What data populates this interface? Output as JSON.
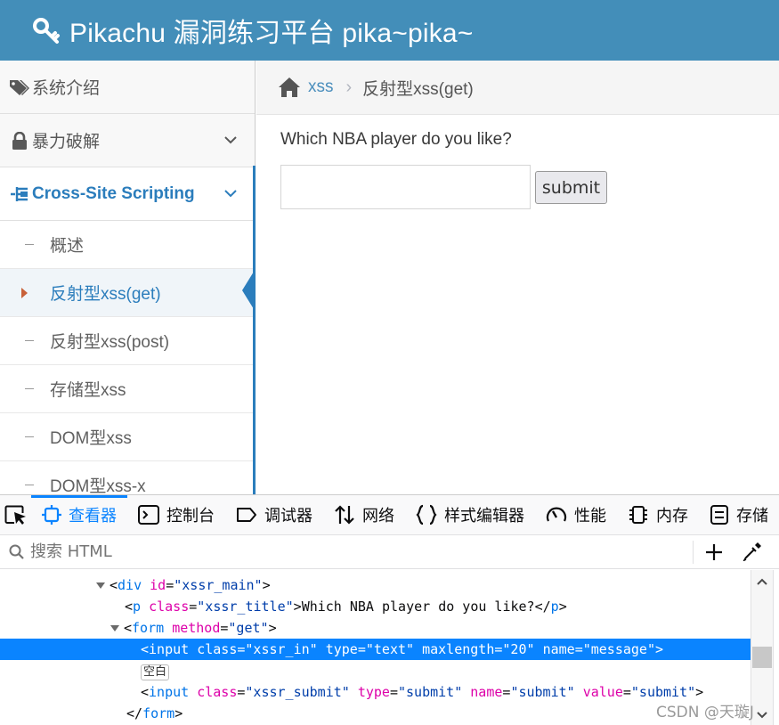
{
  "header": {
    "title": "Pikachu 漏洞练习平台 pika~pika~"
  },
  "sidebar": {
    "items": [
      {
        "label": "系统介绍",
        "icon": "tags-icon"
      },
      {
        "label": "暴力破解",
        "icon": "lock-icon"
      },
      {
        "label": "Cross-Site Scripting",
        "icon": "list-tree-icon"
      }
    ],
    "submenu": [
      {
        "label": "概述"
      },
      {
        "label": "反射型xss(get)"
      },
      {
        "label": "反射型xss(post)"
      },
      {
        "label": "存储型xss"
      },
      {
        "label": "DOM型xss"
      },
      {
        "label": "DOM型xss-x"
      }
    ]
  },
  "breadcrumb": {
    "link": "xss",
    "separator": "›",
    "current": "反射型xss(get)"
  },
  "main": {
    "question": "Which NBA player do you like?",
    "input_value": "",
    "submit_label": "submit"
  },
  "devtools": {
    "tabs": [
      {
        "label": "查看器",
        "icon": "inspector-icon"
      },
      {
        "label": "控制台",
        "icon": "console-icon"
      },
      {
        "label": "调试器",
        "icon": "debugger-icon"
      },
      {
        "label": "网络",
        "icon": "network-icon"
      },
      {
        "label": "样式编辑器",
        "icon": "style-editor-icon"
      },
      {
        "label": "性能",
        "icon": "performance-icon"
      },
      {
        "label": "内存",
        "icon": "memory-icon"
      },
      {
        "label": "存储",
        "icon": "storage-icon"
      }
    ],
    "search_placeholder": "搜索 HTML",
    "tree": {
      "div": {
        "tag": "div",
        "attr": "id",
        "val": "\"xssr_main\""
      },
      "p": {
        "tag": "p",
        "attr": "class",
        "val": "\"xssr_title\"",
        "text": "Which NBA player do you like?",
        "close": "p"
      },
      "form": {
        "tag": "form",
        "attr": "method",
        "val": "\"get\""
      },
      "input1": {
        "tag": "input",
        "a1": "class",
        "v1": "\"xssr_in\"",
        "a2": "type",
        "v2": "\"text\"",
        "a3": "maxlength",
        "v3": "\"20\"",
        "a4": "name",
        "v4": "\"message\""
      },
      "whitespace_badge": "空白",
      "input2": {
        "tag": "input",
        "a1": "class",
        "v1": "\"xssr_submit\"",
        "a2": "type",
        "v2": "\"submit\"",
        "a3": "name",
        "v3": "\"submit\"",
        "a4": "value",
        "v4": "\"submit\""
      },
      "form_close": "form"
    }
  },
  "watermark": "CSDN @天璇J"
}
